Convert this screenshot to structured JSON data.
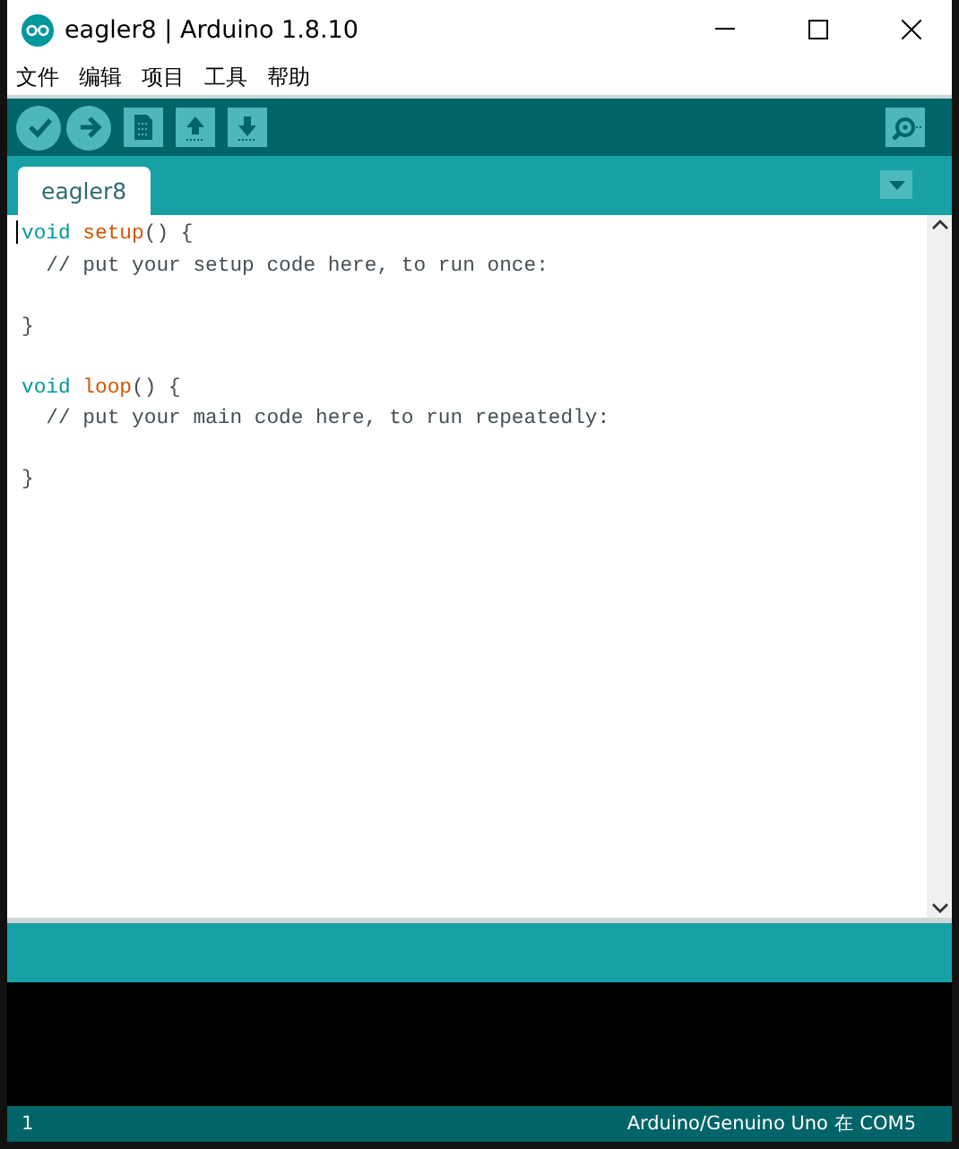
{
  "window": {
    "title": "eagler8 | Arduino 1.8.10"
  },
  "menu": [
    "文件",
    "编辑",
    "项目",
    "工具",
    "帮助"
  ],
  "toolbar": [
    {
      "kind": "verify"
    },
    {
      "kind": "upload"
    },
    {
      "kind": "new"
    },
    {
      "kind": "open"
    },
    {
      "kind": "save"
    }
  ],
  "tabs": [
    {
      "label": "eagler8",
      "selected": true
    }
  ],
  "editor": {
    "lines": [
      {
        "tokens": [
          {
            "kind": "keyword",
            "text": "void"
          },
          {
            "kind": "function",
            "text": "setup"
          },
          {
            "kind": "plain",
            "text": "() {"
          }
        ],
        "blank_after": false
      },
      {
        "tokens": [
          {
            "kind": "comment",
            "text": "  // put your setup code here, to run once:"
          }
        ],
        "blank_after": true
      },
      {
        "tokens": [
          {
            "kind": "plain",
            "text": "}"
          }
        ],
        "blank_after": true
      },
      {
        "tokens": [
          {
            "kind": "keyword",
            "text": "void"
          },
          {
            "kind": "function",
            "text": "loop"
          },
          {
            "kind": "plain",
            "text": "() {"
          }
        ],
        "blank_after": false
      },
      {
        "tokens": [
          {
            "kind": "comment",
            "text": "  // put your main code here, to run repeatedly:"
          }
        ],
        "blank_after": true
      },
      {
        "tokens": [
          {
            "kind": "plain",
            "text": "}"
          }
        ],
        "blank_after": false
      }
    ]
  },
  "status_bar": {
    "line": "1",
    "board": "Arduino/Genuino Uno 在 COM5"
  }
}
